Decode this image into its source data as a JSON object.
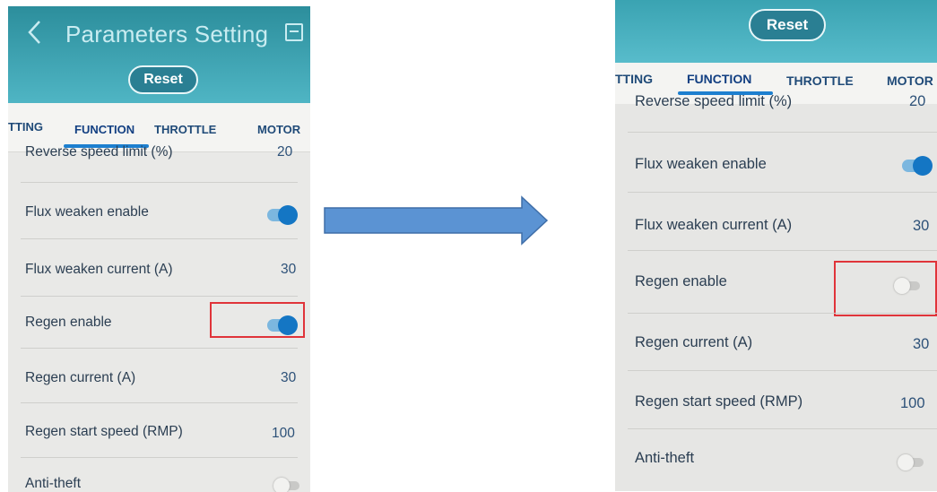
{
  "before": {
    "header": {
      "title": "Parameters Setting",
      "reset_label": "Reset"
    },
    "tabs": [
      "TTING",
      "FUNCTION",
      "THROTTLE",
      "MOTOR"
    ],
    "active_tab": "FUNCTION",
    "rows": [
      {
        "label": "Reverse speed limit (%)",
        "value": "20"
      },
      {
        "label": "Flux weaken enable",
        "toggle": "on"
      },
      {
        "label": "Flux weaken current (A)",
        "value": "30"
      },
      {
        "label": "Regen enable",
        "toggle": "on"
      },
      {
        "label": "Regen current (A)",
        "value": "30"
      },
      {
        "label": "Regen start speed (RMP)",
        "value": "100"
      },
      {
        "label": "Anti-theft",
        "toggle": "off"
      }
    ]
  },
  "after": {
    "header": {
      "reset_label": "Reset"
    },
    "tabs": [
      "TTING",
      "FUNCTION",
      "THROTTLE",
      "MOTOR"
    ],
    "active_tab": "FUNCTION",
    "rows": [
      {
        "label": "Reverse speed limit (%)",
        "value": "20"
      },
      {
        "label": "Flux weaken enable",
        "toggle": "on"
      },
      {
        "label": "Flux weaken current (A)",
        "value": "30"
      },
      {
        "label": "Regen enable",
        "toggle": "off"
      },
      {
        "label": "Regen current (A)",
        "value": "30"
      },
      {
        "label": "Regen start speed (RMP)",
        "value": "100"
      },
      {
        "label": "Anti-theft",
        "toggle": "off"
      }
    ]
  },
  "colors": {
    "header": "#3aa3b2",
    "reset_button": "#2a7f93",
    "tab_text": "#1f4a78",
    "tab_underline": "#1d7fcf",
    "toggle_on": "#1476c4",
    "highlight": "#e0343a",
    "arrow_fill": "#5b93d3",
    "arrow_stroke": "#3f6ea8"
  },
  "icons": {
    "back": "chevron-left-icon",
    "save": "save-icon",
    "arrow": "right-arrow-icon"
  }
}
